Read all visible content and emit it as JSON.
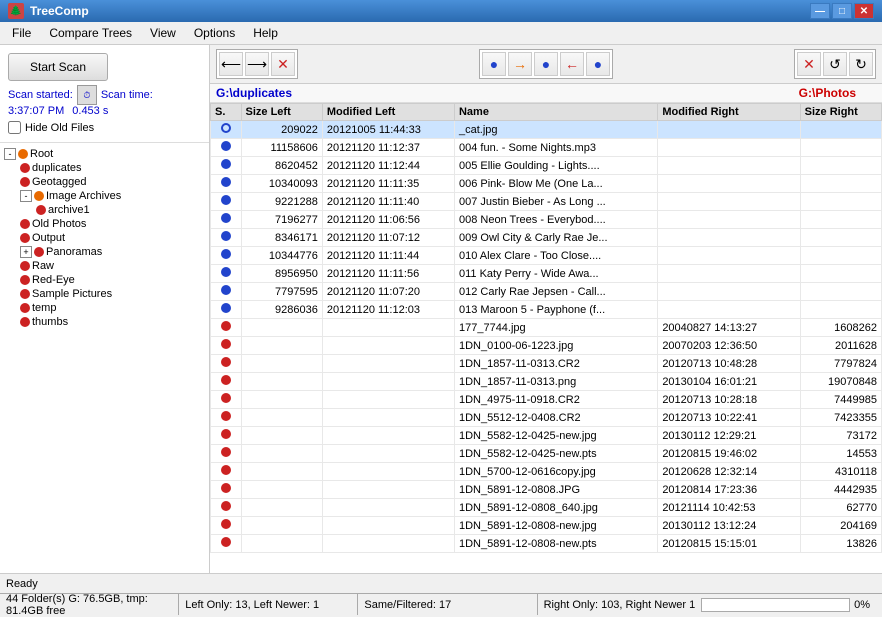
{
  "titleBar": {
    "title": "TreeComp",
    "minimize": "—",
    "maximize": "□",
    "close": "✕"
  },
  "menu": {
    "items": [
      "File",
      "Compare Trees",
      "View",
      "Options",
      "Help"
    ]
  },
  "leftPanel": {
    "scanButton": "Start Scan",
    "scanStarted": "Scan started:",
    "scanTime": "Scan time:",
    "scanStartValue": "3:37:07 PM",
    "scanTimeValue": "0.453 s",
    "hideFilesLabel": "Hide Old Files",
    "tree": {
      "root": "Root",
      "items": [
        {
          "label": "duplicates",
          "indent": 1,
          "dot": "red"
        },
        {
          "label": "Geotagged",
          "indent": 1,
          "dot": "red"
        },
        {
          "label": "Image Archives",
          "indent": 1,
          "dot": "orange",
          "expand": true
        },
        {
          "label": "archive1",
          "indent": 2,
          "dot": "red"
        },
        {
          "label": "Old Photos",
          "indent": 1,
          "dot": "red"
        },
        {
          "label": "Output",
          "indent": 1,
          "dot": "red"
        },
        {
          "label": "Panoramas",
          "indent": 1,
          "dot": "red",
          "expand": true
        },
        {
          "label": "Raw",
          "indent": 1,
          "dot": "red"
        },
        {
          "label": "Red-Eye",
          "indent": 1,
          "dot": "red"
        },
        {
          "label": "Sample Pictures",
          "indent": 1,
          "dot": "red"
        },
        {
          "label": "temp",
          "indent": 1,
          "dot": "red"
        },
        {
          "label": "thumbs",
          "indent": 1,
          "dot": "red"
        }
      ]
    }
  },
  "rightPanel": {
    "pathLeft": "G:\\duplicates",
    "pathRight": "G:\\Photos",
    "columns": [
      "S.",
      "Size Left",
      "Modified Left",
      "Name",
      "Modified Right",
      "Size Right"
    ],
    "rows": [
      {
        "dot": "blue-outline",
        "sizeLeft": "209022",
        "modLeft": "20121005 11:44:33",
        "name": "_cat.jpg",
        "modRight": "",
        "sizeRight": "",
        "dotType": "blue-outline"
      },
      {
        "dot": "blue",
        "sizeLeft": "11158606",
        "modLeft": "20121120 11:12:37",
        "name": "004 fun. - Some Nights.mp3",
        "modRight": "",
        "sizeRight": "",
        "dotType": "blue"
      },
      {
        "dot": "blue",
        "sizeLeft": "8620452",
        "modLeft": "20121120 11:12:44",
        "name": "005 Ellie Goulding - Lights....",
        "modRight": "",
        "sizeRight": "",
        "dotType": "blue"
      },
      {
        "dot": "blue",
        "sizeLeft": "10340093",
        "modLeft": "20121120 11:11:35",
        "name": "006 Pink- Blow Me (One La...",
        "modRight": "",
        "sizeRight": "",
        "dotType": "blue"
      },
      {
        "dot": "blue",
        "sizeLeft": "9221288",
        "modLeft": "20121120 11:11:40",
        "name": "007 Justin Bieber - As Long ...",
        "modRight": "",
        "sizeRight": "",
        "dotType": "blue"
      },
      {
        "dot": "blue",
        "sizeLeft": "7196277",
        "modLeft": "20121120 11:06:56",
        "name": "008 Neon Trees - Everybod....",
        "modRight": "",
        "sizeRight": "",
        "dotType": "blue"
      },
      {
        "dot": "blue",
        "sizeLeft": "8346171",
        "modLeft": "20121120 11:07:12",
        "name": "009 Owl City & Carly Rae Je...",
        "modRight": "",
        "sizeRight": "",
        "dotType": "blue"
      },
      {
        "dot": "blue",
        "sizeLeft": "10344776",
        "modLeft": "20121120 11:11:44",
        "name": "010 Alex Clare - Too Close....",
        "modRight": "",
        "sizeRight": "",
        "dotType": "blue"
      },
      {
        "dot": "blue",
        "sizeLeft": "8956950",
        "modLeft": "20121120 11:11:56",
        "name": "011 Katy Perry - Wide Awa...",
        "modRight": "",
        "sizeRight": "",
        "dotType": "blue"
      },
      {
        "dot": "blue",
        "sizeLeft": "7797595",
        "modLeft": "20121120 11:07:20",
        "name": "012 Carly Rae Jepsen - Call...",
        "modRight": "",
        "sizeRight": "",
        "dotType": "blue"
      },
      {
        "dot": "blue",
        "sizeLeft": "9286036",
        "modLeft": "20121120 11:12:03",
        "name": "013 Maroon 5 - Payphone (f...",
        "modRight": "",
        "sizeRight": "",
        "dotType": "blue"
      },
      {
        "dot": "red",
        "sizeLeft": "",
        "modLeft": "",
        "name": "177_7744.jpg",
        "modRight": "20040827 14:13:27",
        "sizeRight": "1608262",
        "dotType": "red"
      },
      {
        "dot": "red",
        "sizeLeft": "",
        "modLeft": "",
        "name": "1DN_0100-06-1223.jpg",
        "modRight": "20070203 12:36:50",
        "sizeRight": "2011628",
        "dotType": "red"
      },
      {
        "dot": "red",
        "sizeLeft": "",
        "modLeft": "",
        "name": "1DN_1857-11-0313.CR2",
        "modRight": "20120713 10:48:28",
        "sizeRight": "7797824",
        "dotType": "red"
      },
      {
        "dot": "red",
        "sizeLeft": "",
        "modLeft": "",
        "name": "1DN_1857-11-0313.png",
        "modRight": "20130104 16:01:21",
        "sizeRight": "19070848",
        "dotType": "red"
      },
      {
        "dot": "red",
        "sizeLeft": "",
        "modLeft": "",
        "name": "1DN_4975-11-0918.CR2",
        "modRight": "20120713 10:28:18",
        "sizeRight": "7449985",
        "dotType": "red"
      },
      {
        "dot": "red",
        "sizeLeft": "",
        "modLeft": "",
        "name": "1DN_5512-12-0408.CR2",
        "modRight": "20120713 10:22:41",
        "sizeRight": "7423355",
        "dotType": "red"
      },
      {
        "dot": "red",
        "sizeLeft": "",
        "modLeft": "",
        "name": "1DN_5582-12-0425-new.jpg",
        "modRight": "20130112 12:29:21",
        "sizeRight": "73172",
        "dotType": "red"
      },
      {
        "dot": "red",
        "sizeLeft": "",
        "modLeft": "",
        "name": "1DN_5582-12-0425-new.pts",
        "modRight": "20120815 19:46:02",
        "sizeRight": "14553",
        "dotType": "red"
      },
      {
        "dot": "red",
        "sizeLeft": "",
        "modLeft": "",
        "name": "1DN_5700-12-0616copy.jpg",
        "modRight": "20120628 12:32:14",
        "sizeRight": "4310118",
        "dotType": "red"
      },
      {
        "dot": "red",
        "sizeLeft": "",
        "modLeft": "",
        "name": "1DN_5891-12-0808.JPG",
        "modRight": "20120814 17:23:36",
        "sizeRight": "4442935",
        "dotType": "red"
      },
      {
        "dot": "red",
        "sizeLeft": "",
        "modLeft": "",
        "name": "1DN_5891-12-0808_640.jpg",
        "modRight": "20121114 10:42:53",
        "sizeRight": "62770",
        "dotType": "red"
      },
      {
        "dot": "red",
        "sizeLeft": "",
        "modLeft": "",
        "name": "1DN_5891-12-0808-new.jpg",
        "modRight": "20130112 13:12:24",
        "sizeRight": "204169",
        "dotType": "red"
      },
      {
        "dot": "red",
        "sizeLeft": "",
        "modLeft": "",
        "name": "1DN_5891-12-0808-new.pts",
        "modRight": "20120815 15:15:01",
        "sizeRight": "13826",
        "dotType": "red"
      }
    ]
  },
  "statusBar": {
    "ready": "Ready"
  },
  "bottomBar": {
    "leftInfo": "44 Folder(s) G: 76.5GB, tmp: 81.4GB free",
    "leftOnly": "Left Only: 13, Left Newer: 1",
    "sameFiltered": "Same/Filtered: 17",
    "rightOnly": "Right Only: 103, Right Newer 1",
    "progress": "0%"
  },
  "toolbar": {
    "leftButtons": [
      "⟵",
      "⟶",
      "✕"
    ],
    "rightButtons": [
      "●",
      "→",
      "●",
      "←",
      "●"
    ],
    "farRightButtons": [
      "✕",
      "↺",
      "↻"
    ]
  }
}
